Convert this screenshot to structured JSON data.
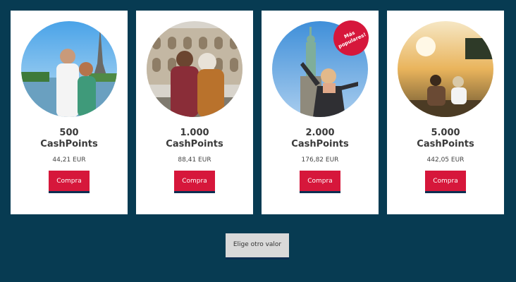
{
  "cards": [
    {
      "points_line1": "500",
      "points_line2": "CashPoints",
      "price": "44,21 EUR",
      "button": "Compra",
      "image": "couple-paris-eiffel"
    },
    {
      "points_line1": "1.000",
      "points_line2": "CashPoints",
      "price": "88,41 EUR",
      "button": "Compra",
      "image": "couple-rome-colosseum"
    },
    {
      "points_line1": "2.000",
      "points_line2": "CashPoints",
      "price": "176,82 EUR",
      "button": "Compra",
      "image": "woman-new-york-liberty",
      "badge": "Más populares!"
    },
    {
      "points_line1": "5.000",
      "points_line2": "CashPoints",
      "price": "442,05 EUR",
      "button": "Compra",
      "image": "couple-sunset-sea"
    }
  ],
  "other_button": "Elige otro valor",
  "colors": {
    "background": "#073b52",
    "accent": "#d6173b",
    "underline": "#0c2e52"
  }
}
